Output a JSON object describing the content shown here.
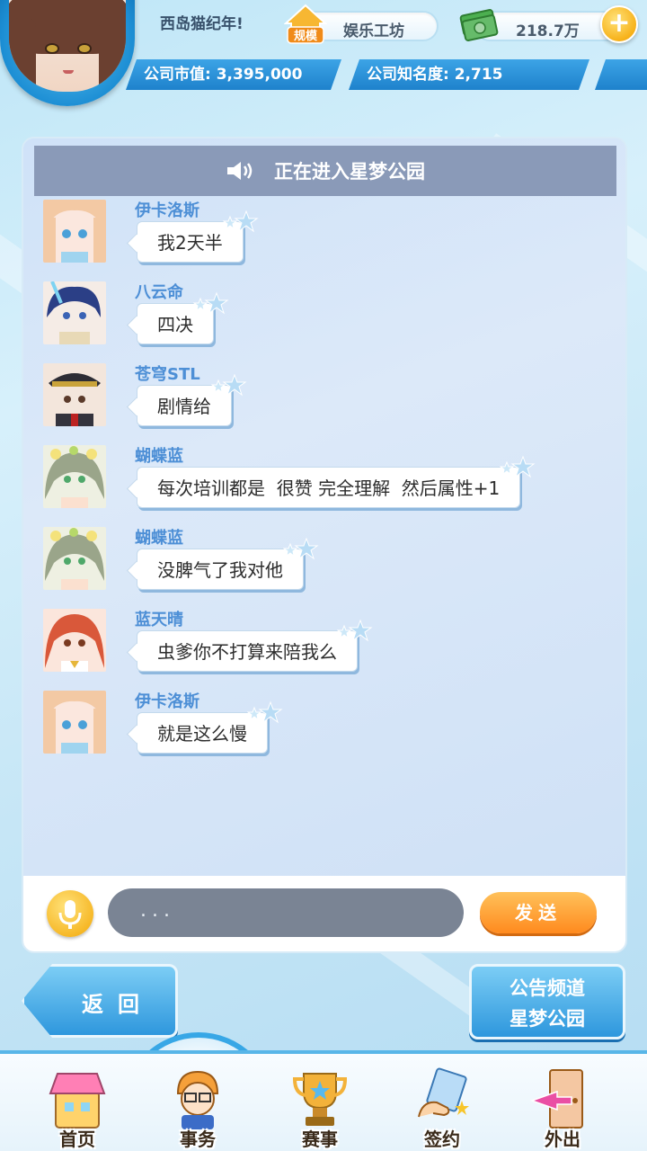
{
  "header": {
    "username": "西岛猫纪年!",
    "scale_badge": "规模",
    "studio_name": "娱乐工坊",
    "money": "218.7万",
    "market_value": "公司市值: 3,395,000",
    "fame": "公司知名度: 2,715"
  },
  "chat": {
    "banner": "正在进入星梦公园",
    "messages": [
      {
        "name": "伊卡洛斯",
        "text": "我2天半"
      },
      {
        "name": "八云命",
        "text": "四决"
      },
      {
        "name": "苍穹STL",
        "text": "剧情给"
      },
      {
        "name": "蝴蝶蓝",
        "text": "每次培训都是  很赞 完全理解  然后属性+1"
      },
      {
        "name": "蝴蝶蓝",
        "text": "没脾气了我对他"
      },
      {
        "name": "蓝天晴",
        "text": "虫爹你不打算来陪我么"
      },
      {
        "name": "伊卡洛斯",
        "text": "就是这么慢"
      }
    ],
    "input_value": "...",
    "send_label": "发送"
  },
  "actions": {
    "back_label": "返回",
    "channel_line1": "公告频道",
    "channel_line2": "星梦公园"
  },
  "nav": {
    "items": [
      {
        "label": "首页"
      },
      {
        "label": "事务"
      },
      {
        "label": "赛事"
      },
      {
        "label": "签约"
      },
      {
        "label": "外出"
      }
    ]
  },
  "colors": {
    "accent_blue": "#2e97dd",
    "send_orange": "#ff8a1e",
    "name_blue": "#4d8fd6"
  }
}
